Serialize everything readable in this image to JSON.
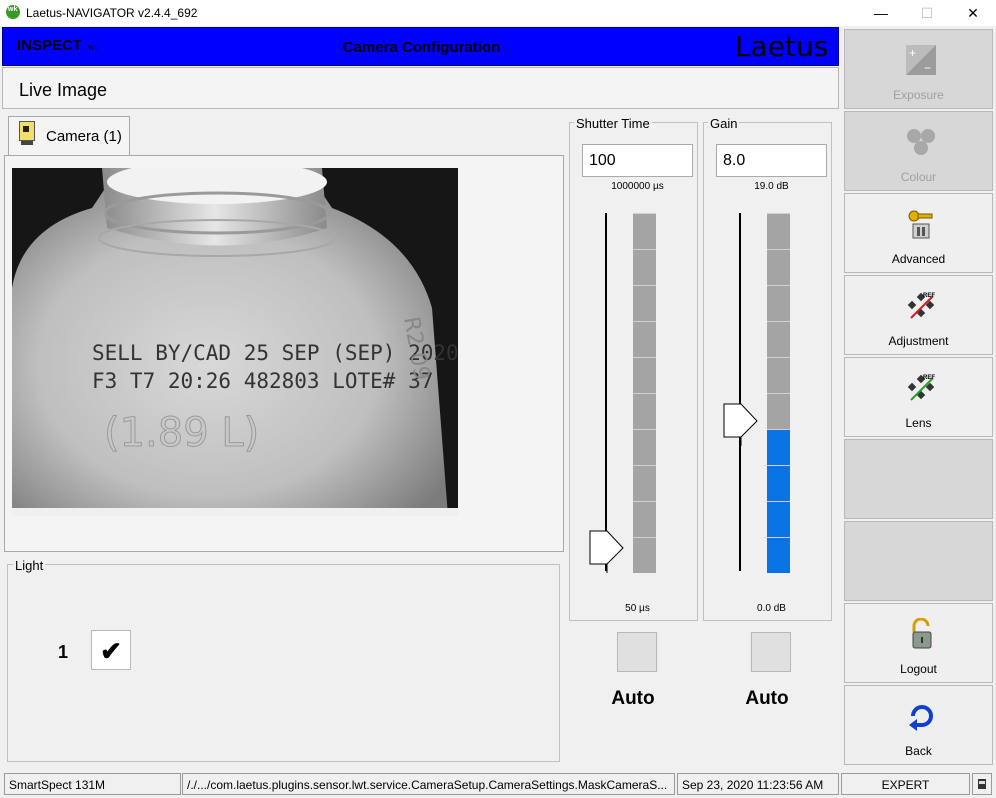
{
  "window": {
    "title": "Laetus-NAVIGATOR v2.4.4_692",
    "minimize": "—",
    "maximize": "☐",
    "close": "✕"
  },
  "header": {
    "product": "INSPECT",
    "product_suffix": "wt",
    "title": "Camera Configuration",
    "brand": "Laetus",
    "bg_color": "#0000ff"
  },
  "live": {
    "title": "Live Image"
  },
  "camera_tab": {
    "label": "Camera (1)"
  },
  "camera_image": {
    "line1": "SELL BY/CAD 25 SEP (SEP) 2020",
    "line2": "F3 T7 20:26 482803 LOTE# 37",
    "line3": "(1.89 L)",
    "edge_text": "R2 09"
  },
  "light": {
    "legend": "Light",
    "number": "1",
    "check": "✔"
  },
  "shutter": {
    "legend": "Shutter Time",
    "value": "100",
    "max_label": "1000000 µs",
    "min_label": "50 µs",
    "level_segments_on": 0,
    "segments_total": 10,
    "auto": "Auto"
  },
  "gain": {
    "legend": "Gain",
    "value": "8.0",
    "max_label": "19.0 dB",
    "min_label": "0.0 dB",
    "level_segments_on": 4,
    "segments_total": 10,
    "auto": "Auto",
    "accent": "#0a73e3"
  },
  "sidebar": {
    "exposure": "Exposure",
    "colour": "Colour",
    "advanced": "Advanced",
    "adjustment": "Adjustment",
    "lens": "Lens",
    "logout": "Logout",
    "back": "Back"
  },
  "status": {
    "device": "SmartSpect 131M",
    "path": "/./.../com.laetus.plugins.sensor.lwt.service.CameraSetup.CameraSettings.MaskCameraS...",
    "datetime": "Sep 23, 2020   11:23:56 AM",
    "mode": "EXPERT"
  }
}
